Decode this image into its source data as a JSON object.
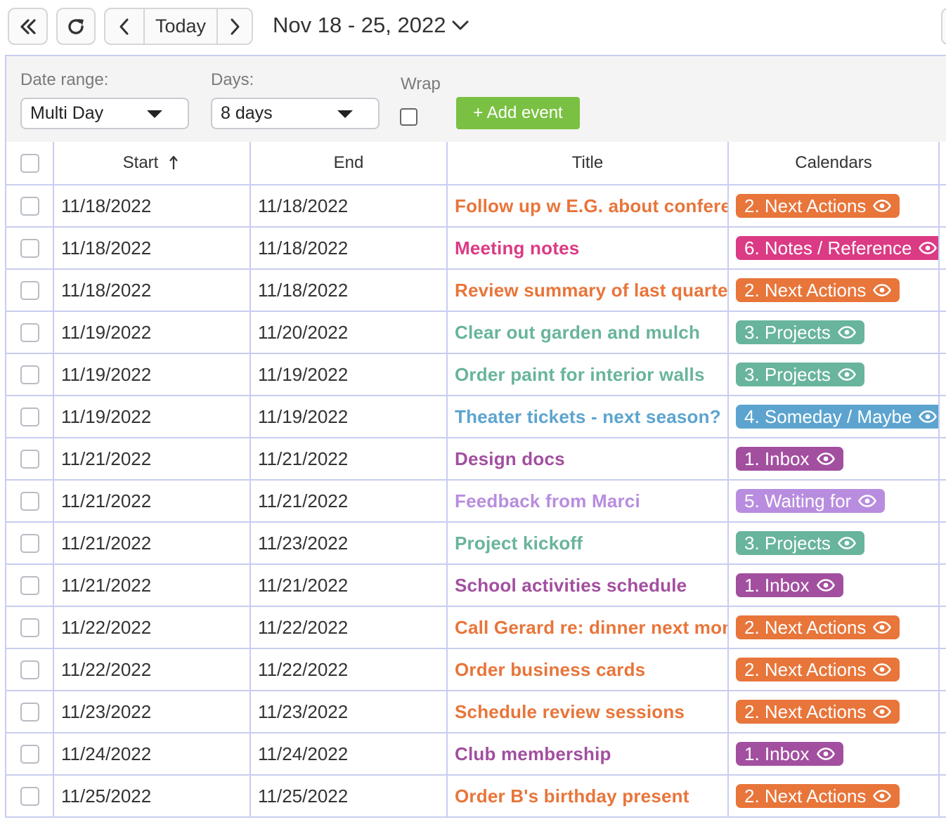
{
  "toolbar": {
    "today_label": "Today",
    "date_range_label": "Nov 18 - 25, 2022"
  },
  "filters": {
    "date_range_label": "Date range:",
    "date_range_value": "Multi Day",
    "days_label": "Days:",
    "days_value": "8 days",
    "wrap_label": "Wrap",
    "add_event_label": "+ Add event"
  },
  "table": {
    "columns": {
      "start": "Start",
      "end": "End",
      "title": "Title",
      "calendars": "Calendars"
    },
    "rows": [
      {
        "start": "11/18/2022",
        "end": "11/18/2022",
        "title": "Follow up w E.G. about conference",
        "calendar": "2. Next Actions",
        "color": "#e8753a"
      },
      {
        "start": "11/18/2022",
        "end": "11/18/2022",
        "title": "Meeting notes",
        "calendar": "6. Notes / Reference",
        "color": "#db3a84"
      },
      {
        "start": "11/18/2022",
        "end": "11/18/2022",
        "title": "Review summary of last quarter",
        "calendar": "2. Next Actions",
        "color": "#e8753a"
      },
      {
        "start": "11/19/2022",
        "end": "11/20/2022",
        "title": "Clear out garden and mulch",
        "calendar": "3. Projects",
        "color": "#68b49c"
      },
      {
        "start": "11/19/2022",
        "end": "11/19/2022",
        "title": "Order paint for interior walls",
        "calendar": "3. Projects",
        "color": "#68b49c"
      },
      {
        "start": "11/19/2022",
        "end": "11/19/2022",
        "title": "Theater tickets - next season?",
        "calendar": "4. Someday / Maybe",
        "color": "#5ca4cf"
      },
      {
        "start": "11/21/2022",
        "end": "11/21/2022",
        "title": "Design docs",
        "calendar": "1. Inbox",
        "color": "#a24f9f"
      },
      {
        "start": "11/21/2022",
        "end": "11/21/2022",
        "title": "Feedback from Marci",
        "calendar": "5. Waiting for",
        "color": "#b88ddf"
      },
      {
        "start": "11/21/2022",
        "end": "11/23/2022",
        "title": "Project kickoff",
        "calendar": "3. Projects",
        "color": "#68b49c"
      },
      {
        "start": "11/21/2022",
        "end": "11/21/2022",
        "title": "School activities schedule",
        "calendar": "1. Inbox",
        "color": "#a24f9f"
      },
      {
        "start": "11/22/2022",
        "end": "11/22/2022",
        "title": "Call Gerard re: dinner next month",
        "calendar": "2. Next Actions",
        "color": "#e8753a"
      },
      {
        "start": "11/22/2022",
        "end": "11/22/2022",
        "title": "Order business cards",
        "calendar": "2. Next Actions",
        "color": "#e8753a"
      },
      {
        "start": "11/23/2022",
        "end": "11/23/2022",
        "title": "Schedule review sessions",
        "calendar": "2. Next Actions",
        "color": "#e8753a"
      },
      {
        "start": "11/24/2022",
        "end": "11/24/2022",
        "title": "Club membership",
        "calendar": "1. Inbox",
        "color": "#a24f9f"
      },
      {
        "start": "11/25/2022",
        "end": "11/25/2022",
        "title": "Order B's birthday present",
        "calendar": "2. Next Actions",
        "color": "#e8753a"
      }
    ]
  }
}
